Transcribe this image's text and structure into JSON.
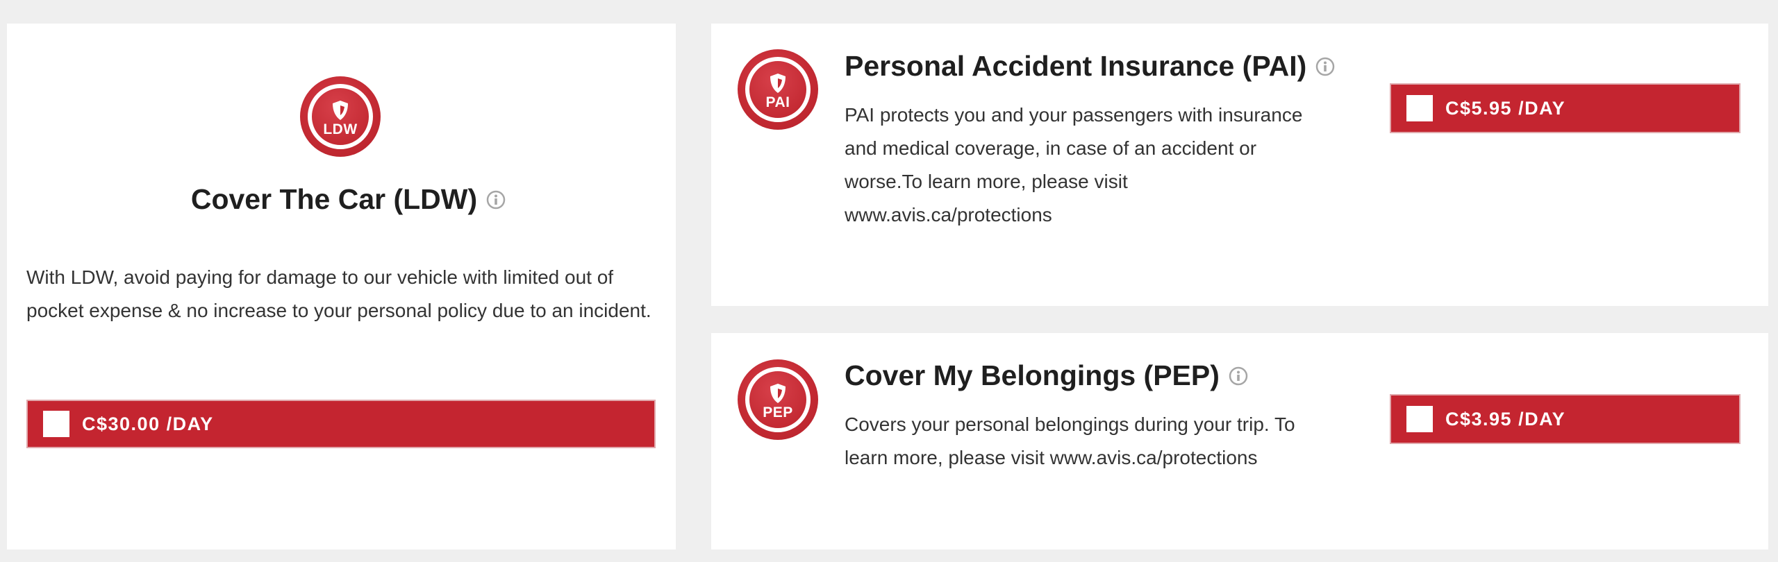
{
  "colors": {
    "accent": "#c42530",
    "background": "#efefef",
    "card": "#ffffff"
  },
  "products": [
    {
      "badge": "LDW",
      "title": "Cover The Car (LDW)",
      "description": "With LDW, avoid paying for damage to our vehicle with limited out of pocket expense & no increase to your personal policy due to an incident.",
      "price": "C$30.00 /DAY",
      "checked": false,
      "icons": [
        "shield-icon",
        "info-icon"
      ]
    },
    {
      "badge": "PAI",
      "title": "Personal Accident Insurance (PAI)",
      "description": "PAI protects you and your passengers with insurance and medical coverage, in case of an accident or worse.To learn more, please visit www.avis.ca/protections",
      "price": "C$5.95 /DAY",
      "checked": false,
      "icons": [
        "shield-icon",
        "info-icon"
      ]
    },
    {
      "badge": "PEP",
      "title": "Cover My Belongings (PEP)",
      "description": "Covers your personal belongings during your trip. To learn more, please visit www.avis.ca/protections",
      "price": "C$3.95 /DAY",
      "checked": false,
      "icons": [
        "shield-icon",
        "info-icon"
      ]
    }
  ]
}
